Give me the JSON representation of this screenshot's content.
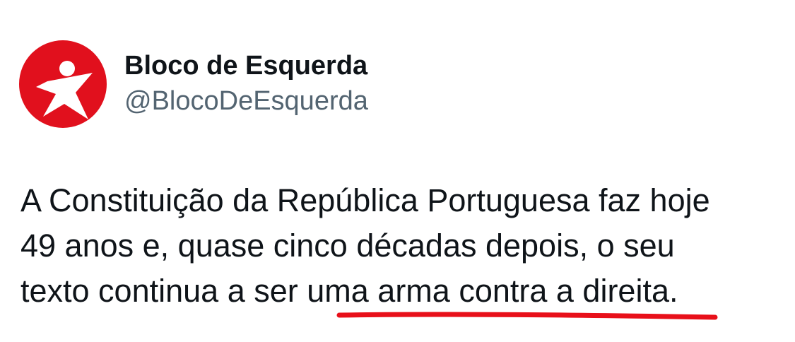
{
  "author": {
    "display_name": "Bloco de Esquerda",
    "handle": "@BlocoDeEsquerda",
    "avatar_icon": "bloco-star-logo-icon",
    "avatar_color": "#e1101d"
  },
  "tweet": {
    "line1": "A Constituição da República Portuguesa faz hoje",
    "line2": "49 anos e, quase cinco décadas depois, o seu",
    "line3_prefix": "texto continua a ser ",
    "line3_highlight": "uma arma contra a direita",
    "line3_suffix": "."
  },
  "annotation": {
    "underline_color": "#e8101a"
  },
  "colors": {
    "text": "#0f1419",
    "secondary_text": "#536471",
    "background": "#ffffff"
  }
}
